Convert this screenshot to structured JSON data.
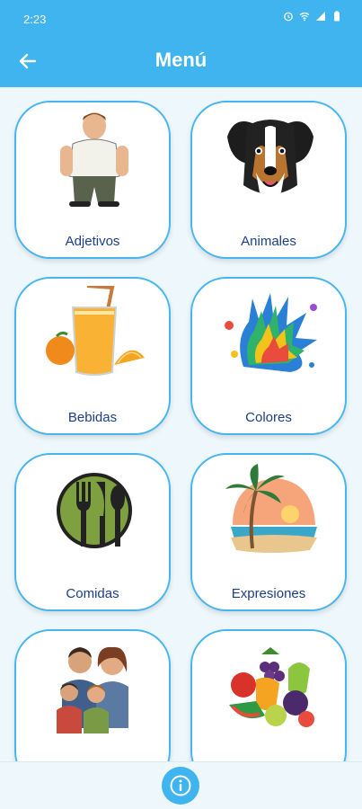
{
  "status": {
    "time": "2:23"
  },
  "appbar": {
    "title": "Menú",
    "back_icon": "arrow-left-icon"
  },
  "colors": {
    "accent": "#3fb4ee",
    "card_border": "#47b6ee",
    "label": "#1b3f86",
    "background": "#eef8fc"
  },
  "menu": {
    "items": [
      {
        "label": "Adjetivos",
        "icon": "man-icon"
      },
      {
        "label": "Animales",
        "icon": "dog-icon"
      },
      {
        "label": "Bebidas",
        "icon": "juice-icon"
      },
      {
        "label": "Colores",
        "icon": "paint-splash-icon"
      },
      {
        "label": "Comidas",
        "icon": "cutlery-icon"
      },
      {
        "label": "Expresiones",
        "icon": "beach-icon"
      },
      {
        "label": "",
        "icon": "family-icon"
      },
      {
        "label": "",
        "icon": "fruits-icon"
      }
    ]
  },
  "bottom": {
    "info_icon": "info-icon"
  }
}
